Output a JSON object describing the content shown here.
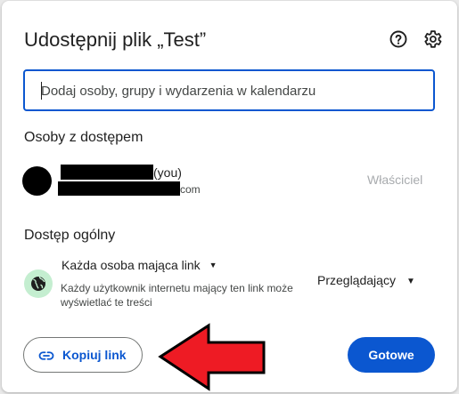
{
  "dialog": {
    "title": "Udostępnij plik „Test”",
    "help_icon": "help-circle-icon",
    "settings_icon": "gear-icon"
  },
  "search": {
    "placeholder": "Dodaj osoby, grupy i wydarzenia w kalendarzu",
    "value": ""
  },
  "people_section": {
    "heading": "Osoby z dostępem",
    "people": [
      {
        "name_suffix": "(you)",
        "email_suffix": "com",
        "role": "Właściciel"
      }
    ]
  },
  "general_access": {
    "heading": "Dostęp ogólny",
    "icon": "globe-icon",
    "selected_option": "Każda osoba mająca link",
    "description": "Każdy użytkownik internetu mający ten link może wyświetlać te treści",
    "role": "Przeglądający"
  },
  "footer": {
    "copy_link_label": "Kopiuj link",
    "copy_link_icon": "link-icon",
    "done_label": "Gotowe"
  },
  "colors": {
    "accent": "#0b57d0",
    "annotation_arrow": "#ee1b24",
    "globe_background": "#c4eed0"
  }
}
